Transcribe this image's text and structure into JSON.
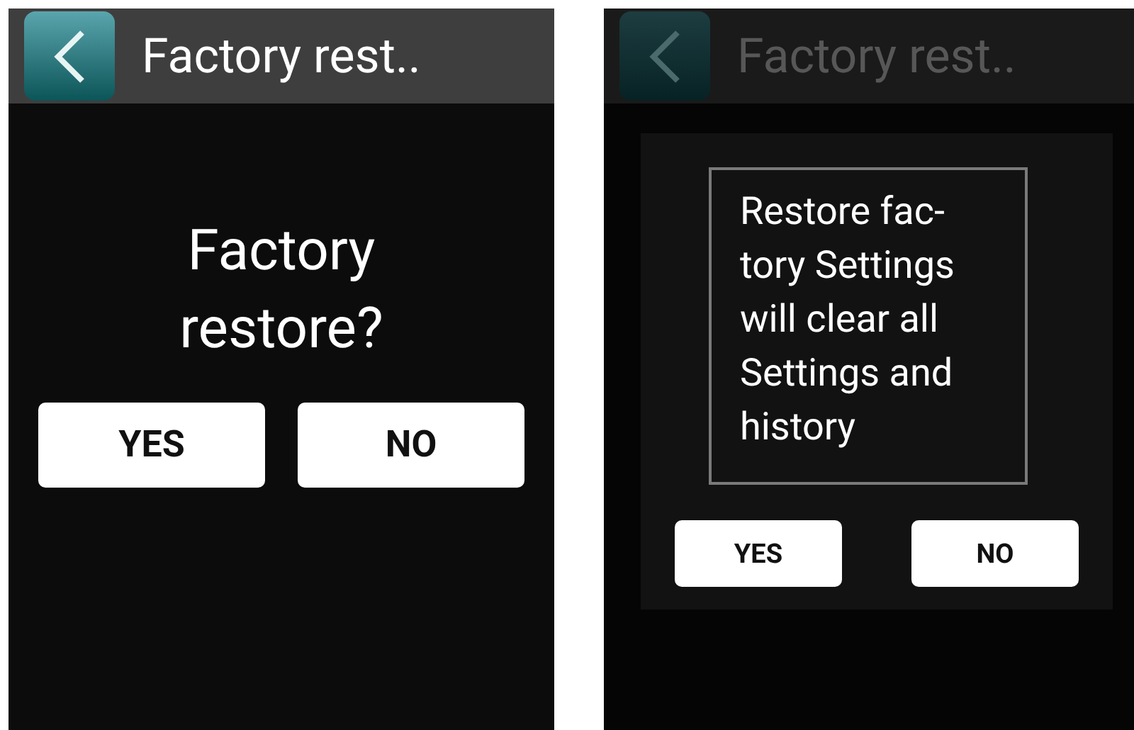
{
  "screens": [
    {
      "kind": "question",
      "header": {
        "title": "Factory rest..",
        "dimmed": false
      },
      "question": "Factory restore?",
      "buttons": [
        "YES",
        "NO"
      ]
    },
    {
      "kind": "dialog",
      "header": {
        "title": "Factory rest..",
        "dimmed": true
      },
      "message": "Restore fac-tory Settings will clear all Settings and history",
      "buttons": [
        "YES",
        "NO"
      ]
    }
  ]
}
